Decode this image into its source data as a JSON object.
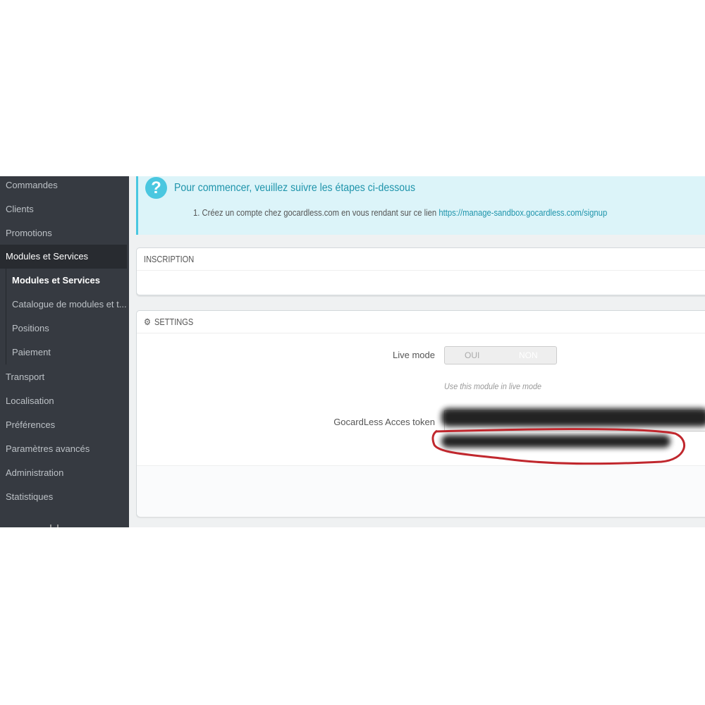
{
  "sidebar": {
    "items": [
      "Commandes",
      "Clients",
      "Promotions",
      "Modules et Services",
      "Transport",
      "Localisation",
      "Préférences",
      "Paramètres avancés",
      "Administration",
      "Statistiques"
    ],
    "active": "Modules et Services",
    "subitems": [
      "Modules et Services",
      "Catalogue de modules et t...",
      "Positions",
      "Paiement"
    ]
  },
  "alert": {
    "icon": "question-circle-icon",
    "title": "Pour commencer, veuillez suivre les étapes ci-dessous",
    "step": "1. Créez un compte chez gocardless.com en vous rendant sur ce lien ",
    "link": "https://manage-sandbox.gocardless.com/signup"
  },
  "inscription": {
    "title": "INSCRIPTION"
  },
  "settings": {
    "icon": "cogs-icon",
    "title": "SETTINGS",
    "live_mode_label": "Live mode",
    "live_mode_on": "OUI",
    "live_mode_off": "NON",
    "live_mode_help": "Use this module in live mode",
    "token_label": "GocardLess Acces token"
  },
  "colors": {
    "sidebar": "#363a41",
    "accent": "#25b9d7",
    "annotation": "#c0272d"
  }
}
